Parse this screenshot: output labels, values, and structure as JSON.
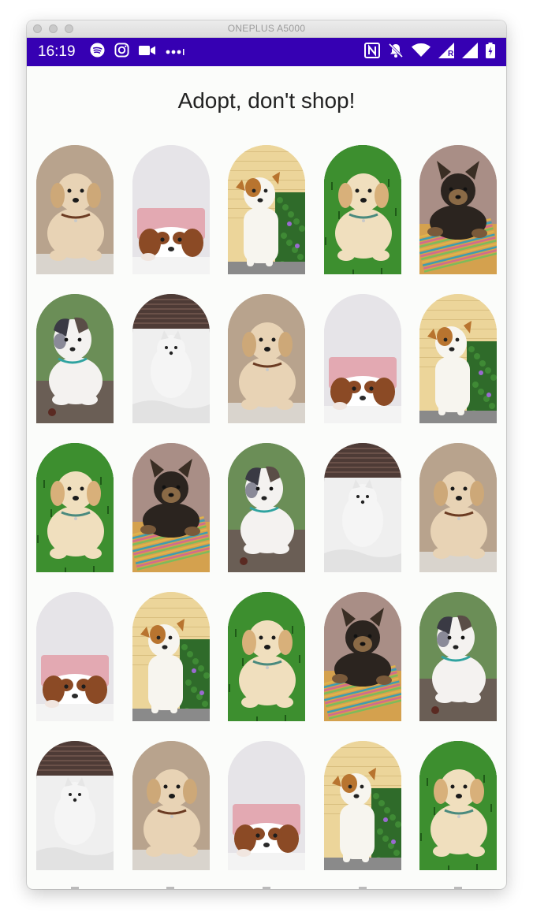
{
  "window": {
    "title": "ONEPLUS A5000"
  },
  "status_bar": {
    "time": "16:19",
    "left_icons": [
      "spotify-icon",
      "instagram-icon",
      "video-icon",
      "more-dots-icon"
    ],
    "right_icons": [
      "nfc-icon",
      "notifications-off-icon",
      "wifi-icon",
      "signal-roaming-icon",
      "signal-icon",
      "battery-charging-icon"
    ],
    "roaming_label": "R",
    "background": "#3600b3"
  },
  "page": {
    "heading": "Adopt, don't shop!"
  },
  "puppy_kinds": {
    "golden-lying": {
      "bg": "#b8a38d",
      "floor": "#d9d4cd",
      "coat": "#e8d3b5",
      "ear": "#cda878",
      "collar": "#6b3b22"
    },
    "cavalier-peek": {
      "bg": "#e6e4e8",
      "floor": "#f3f3f3",
      "coat": "#ffffff",
      "ear": "#8b4a25",
      "pillow": "#e3a9b2"
    },
    "jack-russell": {
      "bg": "#ecd59a",
      "floor": "#2f6b2a",
      "coat": "#f7f5ef",
      "ear": "#b8742f"
    },
    "golden-grass": {
      "bg": "#2a7a22",
      "floor": "#3d8f2f",
      "coat": "#f0dfbe",
      "ear": "#d8b07a",
      "collar": "#4a8a7e"
    },
    "yorkie-rug": {
      "bg": "#a98e86",
      "floor": "#d4a14e",
      "coat": "#2b241f",
      "ear": "#3a2e24",
      "rug": [
        "#e0b34a",
        "#3e9db0",
        "#d46a8c",
        "#7dbb5b"
      ]
    },
    "aussie-rug": {
      "bg": "#6b8e57",
      "floor": "#6a5e55",
      "coat": "#f4f2f0",
      "ear": "#3a3a44",
      "collar": "#2fa3a0"
    },
    "white-spitz": {
      "bg": "#4e3b36",
      "floor": "#efefef",
      "coat": "#f5f5f5",
      "ear": "#e6e6e6"
    }
  },
  "grid": {
    "columns": 5,
    "cards": [
      {
        "kind": "golden-lying",
        "alt": "golden retriever puppy"
      },
      {
        "kind": "cavalier-peek",
        "alt": "cavalier puppy"
      },
      {
        "kind": "jack-russell",
        "alt": "jack russell puppy"
      },
      {
        "kind": "golden-grass",
        "alt": "golden puppy on grass"
      },
      {
        "kind": "yorkie-rug",
        "alt": "yorkie puppy"
      },
      {
        "kind": "aussie-rug",
        "alt": "aussie puppy"
      },
      {
        "kind": "white-spitz",
        "alt": "white spitz puppy"
      },
      {
        "kind": "golden-lying",
        "alt": "golden retriever puppy"
      },
      {
        "kind": "cavalier-peek",
        "alt": "cavalier puppy"
      },
      {
        "kind": "jack-russell",
        "alt": "jack russell puppy"
      },
      {
        "kind": "golden-grass",
        "alt": "golden puppy on grass"
      },
      {
        "kind": "yorkie-rug",
        "alt": "yorkie puppy"
      },
      {
        "kind": "aussie-rug",
        "alt": "aussie puppy"
      },
      {
        "kind": "white-spitz",
        "alt": "white spitz puppy"
      },
      {
        "kind": "golden-lying",
        "alt": "golden retriever puppy"
      },
      {
        "kind": "cavalier-peek",
        "alt": "cavalier puppy"
      },
      {
        "kind": "jack-russell",
        "alt": "jack russell puppy"
      },
      {
        "kind": "golden-grass",
        "alt": "golden puppy on grass"
      },
      {
        "kind": "yorkie-rug",
        "alt": "yorkie puppy"
      },
      {
        "kind": "aussie-rug",
        "alt": "aussie puppy"
      },
      {
        "kind": "white-spitz",
        "alt": "white spitz puppy"
      },
      {
        "kind": "golden-lying",
        "alt": "golden retriever puppy"
      },
      {
        "kind": "cavalier-peek",
        "alt": "cavalier puppy"
      },
      {
        "kind": "jack-russell",
        "alt": "jack russell puppy"
      },
      {
        "kind": "golden-grass",
        "alt": "golden puppy on grass"
      }
    ]
  }
}
